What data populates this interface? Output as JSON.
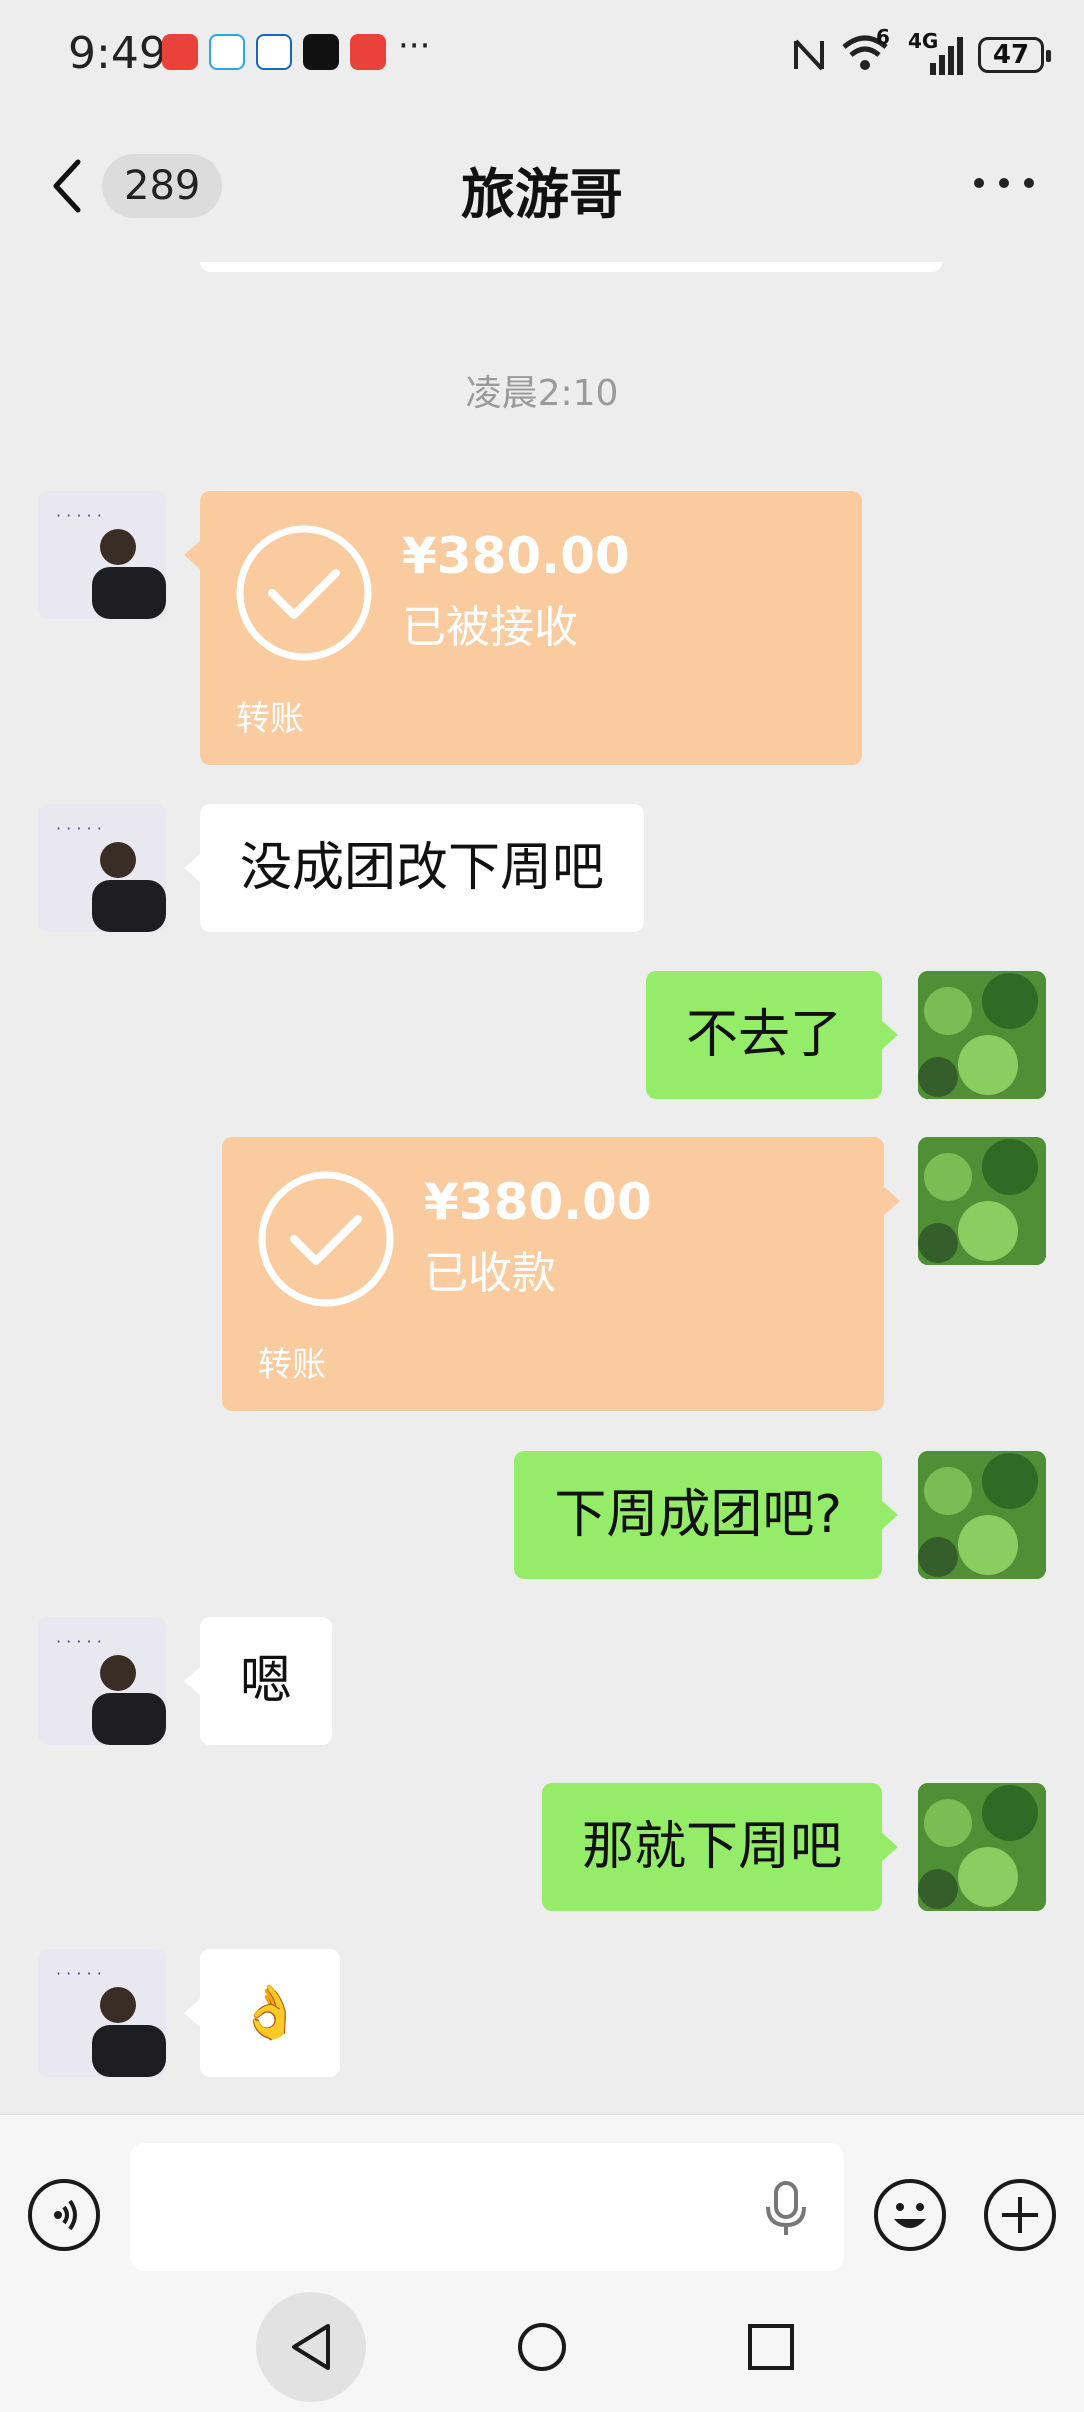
{
  "status_bar": {
    "time": "9:49",
    "battery": "47",
    "network": "4G",
    "signal_label": "6",
    "overflow": "···"
  },
  "header": {
    "unread_count": "289",
    "title": "旅游哥"
  },
  "chat": {
    "timestamp": "凌晨2:10",
    "messages": [
      {
        "side": "left",
        "type": "transfer",
        "amount": "¥380.00",
        "status": "已被接收",
        "footer": "转账"
      },
      {
        "side": "left",
        "type": "text",
        "text": "没成团改下周吧"
      },
      {
        "side": "right",
        "type": "text",
        "text": "不去了"
      },
      {
        "side": "right",
        "type": "transfer",
        "amount": "¥380.00",
        "status": "已收款",
        "footer": "转账"
      },
      {
        "side": "right",
        "type": "text",
        "text": "下周成团吧?"
      },
      {
        "side": "left",
        "type": "text",
        "text": "嗯"
      },
      {
        "side": "right",
        "type": "text",
        "text": "那就下周吧"
      },
      {
        "side": "left",
        "type": "emoji",
        "text": "👌"
      }
    ]
  },
  "input_bar": {
    "value": "",
    "icons": [
      "voice-mode-icon",
      "microphone-icon",
      "emoji-icon",
      "plus-icon"
    ]
  },
  "system_nav": {
    "icons": [
      "back-triangle-icon",
      "home-circle-icon",
      "recents-square-icon"
    ]
  },
  "colors": {
    "bg": "#ededed",
    "incoming_bubble": "#ffffff",
    "outgoing_bubble": "#95ec69",
    "transfer_card": "#f9cb9e",
    "timestamp": "#9a9a9a"
  }
}
